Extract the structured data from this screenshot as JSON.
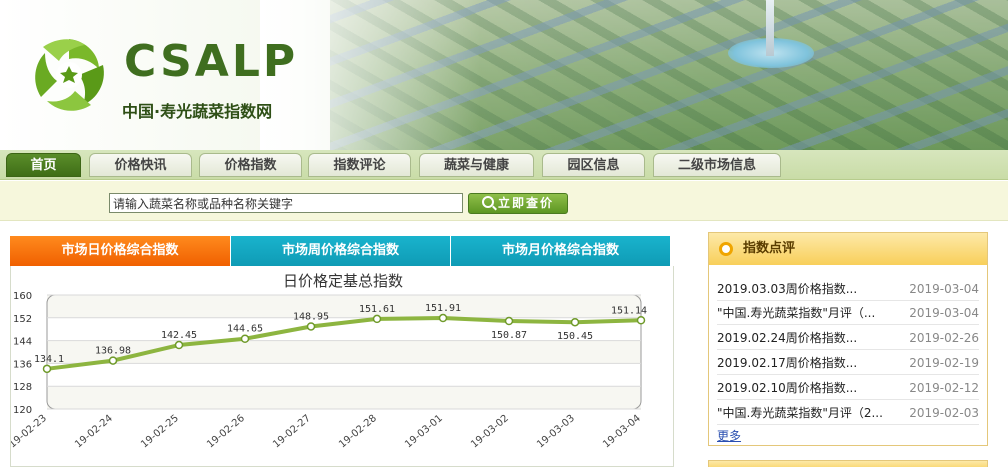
{
  "header": {
    "logo_text": "CSALP",
    "site_name": "中国·寿光蔬菜指数网"
  },
  "nav": {
    "items": [
      {
        "label": "首页",
        "active": true
      },
      {
        "label": "价格快讯",
        "active": false
      },
      {
        "label": "价格指数",
        "active": false
      },
      {
        "label": "指数评论",
        "active": false
      },
      {
        "label": "蔬菜与健康",
        "active": false
      },
      {
        "label": "园区信息",
        "active": false
      },
      {
        "label": "二级市场信息",
        "active": false
      }
    ]
  },
  "search": {
    "input_value": "请输入蔬菜名称或品种名称关键字",
    "button_label": "立即查价"
  },
  "tabs": [
    {
      "label": "市场日价格综合指数",
      "active": true
    },
    {
      "label": "市场周价格综合指数",
      "active": false
    },
    {
      "label": "市场月价格综合指数",
      "active": false
    }
  ],
  "chart_data": {
    "type": "line",
    "title": "日价格定基总指数",
    "xlabel": "",
    "ylabel": "",
    "x": [
      "19-02-23",
      "19-02-24",
      "19-02-25",
      "19-02-26",
      "19-02-27",
      "19-02-28",
      "19-03-01",
      "19-03-02",
      "19-03-03",
      "19-03-04"
    ],
    "series": [
      {
        "values": [
          134.1,
          136.98,
          142.45,
          144.65,
          148.95,
          151.61,
          151.91,
          150.87,
          150.45,
          151.14
        ]
      }
    ],
    "value_labels": [
      "134.1",
      "136.98",
      "142.45",
      "144.65",
      "148.95",
      "151.61",
      "151.91",
      "150.87",
      "150.45",
      "151.14"
    ],
    "yticks": [
      120,
      128,
      136,
      144,
      152,
      160
    ],
    "ylim": [
      120,
      160
    ],
    "grid": true,
    "color": "#8db540"
  },
  "panel": {
    "title": "指数点评",
    "items": [
      {
        "title": "2019.03.03周价格指数...",
        "date": "2019-03-04"
      },
      {
        "title": "\"中国.寿光蔬菜指数\"月评（...",
        "date": "2019-03-04"
      },
      {
        "title": "2019.02.24周价格指数...",
        "date": "2019-02-26"
      },
      {
        "title": "2019.02.17周价格指数...",
        "date": "2019-02-19"
      },
      {
        "title": "2019.02.10周价格指数...",
        "date": "2019-02-12"
      },
      {
        "title": "\"中国.寿光蔬菜指数\"月评（2...",
        "date": "2019-02-03"
      }
    ],
    "more_label": "更多"
  },
  "colors": {
    "nav_active": "#3f6e16",
    "tab_active": "#f06000",
    "tab_inactive": "#0f9bb5",
    "panel_head": "#f8cf5a"
  }
}
